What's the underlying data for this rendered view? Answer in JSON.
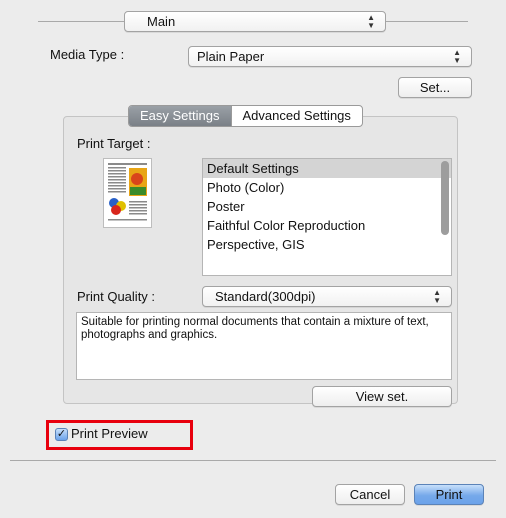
{
  "main_popup": {
    "value": "Main"
  },
  "media_type": {
    "label": "Media Type :",
    "value": "Plain Paper"
  },
  "set_button": {
    "label": "Set..."
  },
  "tabs": [
    {
      "label": "Easy Settings",
      "active": true
    },
    {
      "label": "Advanced Settings",
      "active": false
    }
  ],
  "print_target": {
    "label": "Print Target :",
    "items": [
      "Default Settings",
      "Photo (Color)",
      "Poster",
      "Faithful Color Reproduction",
      "Perspective, GIS"
    ],
    "selected_index": 0
  },
  "print_quality": {
    "label": "Print Quality :",
    "value": "Standard(300dpi)"
  },
  "description": "Suitable for printing normal documents that contain a mixture of text, photographs and graphics.",
  "view_set_button": {
    "label": "View set."
  },
  "print_preview": {
    "label": "Print Preview",
    "checked": true
  },
  "footer": {
    "cancel_label": "Cancel",
    "print_label": "Print"
  },
  "colors": {
    "highlight": "#e8000d",
    "primary_button": "#6ba2ea"
  }
}
